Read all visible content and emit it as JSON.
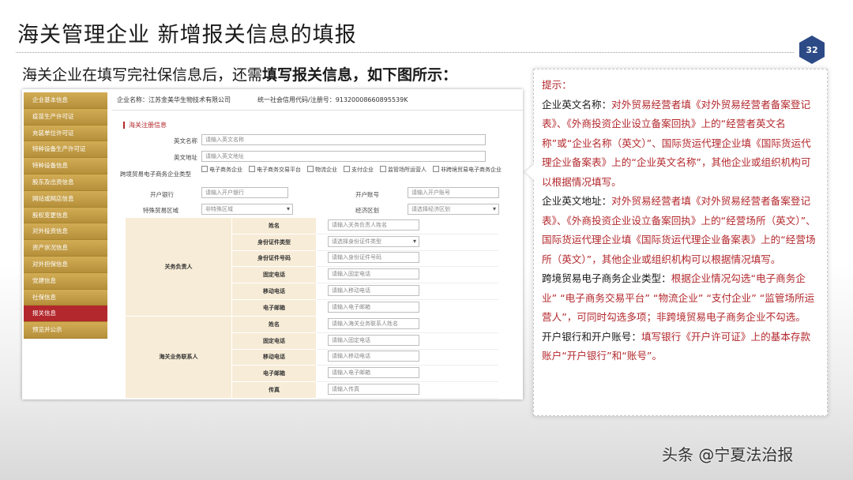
{
  "slide": {
    "title": "海关管理企业  新增报关信息的填报",
    "page_number": "32",
    "subtitle_pre": "海关企业在填写完社保信息后，还需",
    "subtitle_bold": "填写报关信息，如下图所示："
  },
  "form": {
    "sidebar": [
      {
        "label": "企业基本信息",
        "active": false
      },
      {
        "label": "疫苗生产许可证",
        "active": false
      },
      {
        "label": "充装单位许可证",
        "active": false
      },
      {
        "label": "特种设备生产许可证",
        "active": false
      },
      {
        "label": "特种设备信息",
        "active": false
      },
      {
        "label": "股东及出资信息",
        "active": false
      },
      {
        "label": "网站或网店信息",
        "active": false
      },
      {
        "label": "股权变更信息",
        "active": false
      },
      {
        "label": "对外投资信息",
        "active": false
      },
      {
        "label": "资产状况信息",
        "active": false
      },
      {
        "label": "对外担保信息",
        "active": false
      },
      {
        "label": "党建信息",
        "active": false
      },
      {
        "label": "社保信息",
        "active": false
      },
      {
        "label": "报关信息",
        "active": true
      },
      {
        "label": "预览并公示",
        "active": false
      }
    ],
    "company_name": "企业名称：江苏金美华生物技术有限公司",
    "credit_code": "统一社会信用代码/注册号：91320008660895539K",
    "section_title": "海关注册信息",
    "english_name_label": "英文名称",
    "english_name_placeholder": "请输入英文名称",
    "english_address_label": "英文地址",
    "english_address_placeholder": "请输入英文地址",
    "ecommerce_label": "跨境贸易电子商务企业类型",
    "ecommerce_options": [
      "电子商务企业",
      "电子商务交易平台",
      "物流企业",
      "支付企业",
      "监管场所运营人",
      "非跨境贸易电子商务企业"
    ],
    "bank_label": "开户银行",
    "bank_placeholder": "请输入开户银行",
    "account_label": "开户账号",
    "account_placeholder": "请输入开户账号",
    "special_zone_label": "特殊贸易区域",
    "special_zone_value": "非特殊区域",
    "economic_zone_label": "经济区划",
    "economic_zone_value": "请选择经济区划",
    "customs_head": {
      "group": "关务负责人",
      "rows": [
        {
          "label": "姓名",
          "placeholder": "请输入关务负责人姓名",
          "select": false
        },
        {
          "label": "身份证件类型",
          "placeholder": "请选择身份证件类型",
          "select": true
        },
        {
          "label": "身份证件号码",
          "placeholder": "请输入身份证件号码",
          "select": false
        },
        {
          "label": "固定电话",
          "placeholder": "请输入固定电话",
          "select": false
        },
        {
          "label": "移动电话",
          "placeholder": "请输入移动电话",
          "select": false
        },
        {
          "label": "电子邮箱",
          "placeholder": "请输入电子邮箱",
          "select": false
        }
      ]
    },
    "customs_contact": {
      "group": "海关业务联系人",
      "rows": [
        {
          "label": "姓名",
          "placeholder": "请输入海关业务联系人姓名",
          "select": false
        },
        {
          "label": "固定电话",
          "placeholder": "请输入固定电话",
          "select": false
        },
        {
          "label": "移动电话",
          "placeholder": "请输入移动电话",
          "select": false
        },
        {
          "label": "电子邮箱",
          "placeholder": "请输入电子邮箱",
          "select": false
        },
        {
          "label": "传真",
          "placeholder": "请输入传真",
          "select": false
        }
      ]
    }
  },
  "tips": {
    "header": "提示：",
    "items": [
      {
        "term": "企业英文名称：",
        "desc": "对外贸易经营者填《对外贸易经营者备案登记表》、《外商投资企业设立备案回执》上的“经营者英文名称”或“企业名称（英文）”、国际货运代理企业填《国际货运代理企业备案表》上的“企业英文名称”，其他企业或组织机构可以根据情况填写。"
      },
      {
        "term": "企业英文地址：",
        "desc": "对外贸易经营者填《对外贸易经营者备案登记表》、《外商投资企业设立备案回执》上的“经营场所（英文）”、国际货运代理企业填《国际货运代理企业备案表》上的“经营场所（英文）”，其他企业或组织机构可以根据情况填写。"
      },
      {
        "term": "跨境贸易电子商务企业类型：",
        "desc": "根据企业情况勾选“电子商务企业” “电子商务交易平台” “物流企业” “支付企业” “监管场所运营人”，可同时勾选多项；非跨境贸易电子商务企业不勾选。"
      },
      {
        "term": "开户银行和开户账号：",
        "desc": "填写银行《开户许可证》上的基本存款账户“开户银行”和“账号”。"
      }
    ]
  },
  "watermark": "头条 @宁夏法治报",
  "colors": {
    "accent_red": "#b3282d",
    "nav_gold": "#c9a34a",
    "badge_blue": "#2c4a86",
    "cell_beige": "#f7ecd7"
  }
}
